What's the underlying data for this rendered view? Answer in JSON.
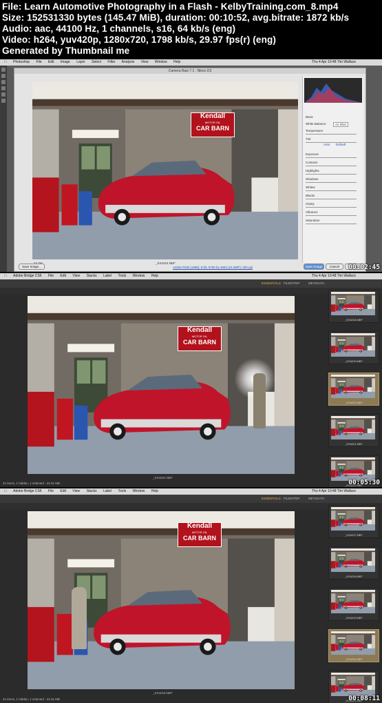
{
  "header": {
    "line1": "File: Learn Automotive Photography in a Flash - KelbyTraining.com_8.mp4",
    "line2": "Size: 152531330 bytes (145.47 MiB), duration: 00:10:52, avg.bitrate: 1872 kb/s",
    "line3": "Audio: aac, 44100 Hz, 1 channels, s16, 64 kb/s (eng)",
    "line4": "Video: h264, yuv420p, 1280x720, 1798 kb/s, 29.97 fps(r) (eng)",
    "line5": "Generated by Thumbnail me"
  },
  "frames": [
    {
      "timestamp": "00:02:45",
      "app": "Photoshop",
      "menus": [
        "File",
        "Edit",
        "Image",
        "Layer",
        "Select",
        "Filter",
        "Analysis",
        "View",
        "Window",
        "Help"
      ],
      "right_menu": "Thu 4 Apr  10:48  Tim Wallace",
      "dialog_title": "Camera Raw 7.1 - Nikon D3",
      "preview_label": "Preview",
      "zoom": "22.7%",
      "filename": "_KS4224.NEF",
      "workflow_link": "Adobe RGB (1998); 8 bit; 5760 by 3840 (21.6MP); 300 ppi",
      "buttons": {
        "save": "Save Image...",
        "open": "Open Image",
        "cancel": "Cancel",
        "done": "Done"
      },
      "panel": {
        "section": "Basic",
        "white_balance_label": "White Balance:",
        "white_balance_value": "As Shot",
        "auto_label": "Auto",
        "default_label": "Default",
        "sliders": [
          "Temperature",
          "Tint",
          "Exposure",
          "Contrast",
          "Highlights",
          "Shadows",
          "Whites",
          "Blacks",
          "Clarity",
          "Vibrance",
          "Saturation"
        ]
      },
      "sign": {
        "line1": "Kendall",
        "line2": "MOTOR OIL",
        "line3": "CAR BARN"
      }
    },
    {
      "timestamp": "00:05:30",
      "app": "Adobe Bridge CS6",
      "menus": [
        "File",
        "Edit",
        "View",
        "Stacks",
        "Label",
        "Tools",
        "Window",
        "Help"
      ],
      "right_menu": "Thu 4 Apr  10:48  Tim Wallace",
      "tabs": [
        "ESSENTIALS",
        "FILMSTRIP",
        "METADATA"
      ],
      "active_tab": "FILMSTRIP",
      "caption": "_KS4224.NEF",
      "thumbnails": [
        "_KS4218.NEF",
        "_KS4219.NEF",
        "_KS4220.NEF",
        "_KS4221.NEF",
        "_KS4222.NEF"
      ],
      "selected_index": 2,
      "status": "31 items, 1 hidden, 1 selected - 23.31 MB",
      "sign": {
        "line1": "Kendall",
        "line2": "MOTOR OIL",
        "line3": "CAR BARN"
      }
    },
    {
      "timestamp": "00:08:11",
      "app": "Adobe Bridge CS6",
      "menus": [
        "File",
        "Edit",
        "View",
        "Stacks",
        "Label",
        "Tools",
        "Window",
        "Help"
      ],
      "right_menu": "Thu 4 Apr  10:48  Tim Wallace",
      "tabs": [
        "ESSENTIALS",
        "FILMSTRIP",
        "METADATA"
      ],
      "active_tab": "FILMSTRIP",
      "caption": "_KS4219.NEF",
      "thumbnails": [
        "_KS4217.NEF",
        "_KS4218.NEF",
        "_KS4219.NEF",
        "_KS4220.NEF",
        "_KS4221.NEF"
      ],
      "selected_index": 3,
      "status": "31 items, 1 hidden, 1 selected - 23.31 MB",
      "sign": {
        "line1": "Kendall",
        "line2": "MOTOR OIL",
        "line3": "CAR BARN"
      }
    }
  ],
  "colors": {
    "car_red": "#c0142a",
    "sign_red": "#b1121c",
    "floor": "#8e99a7",
    "accent_button": "#5b8fd6",
    "selected_thumb": "#8c7a55"
  }
}
